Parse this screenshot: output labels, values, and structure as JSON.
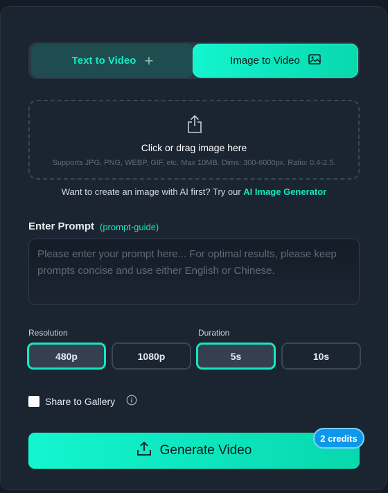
{
  "tabs": {
    "text_to_video": "Text to Video",
    "image_to_video": "Image to Video"
  },
  "upload": {
    "title": "Click or drag image here",
    "hint": "Supports JPG, PNG, WEBP, GIF, etc. Max 10MB. Dims: 300-6000px. Ratio: 0.4-2.5."
  },
  "ai_prompt": {
    "text": "Want to create an image with AI first? Try our ",
    "link": "AI Image Generator"
  },
  "prompt": {
    "label": "Enter Prompt",
    "guide": "(prompt-guide)",
    "value": "",
    "placeholder": "Please enter your prompt here... For optimal results, please keep prompts concise and use either English or Chinese."
  },
  "resolution": {
    "label": "Resolution",
    "options": [
      "480p",
      "1080p"
    ],
    "selected": "480p"
  },
  "duration": {
    "label": "Duration",
    "options": [
      "5s",
      "10s"
    ],
    "selected": "5s"
  },
  "share": {
    "label": "Share to Gallery",
    "checked": false
  },
  "generate": {
    "label": "Generate Video",
    "credits": "2 credits"
  },
  "colors": {
    "accent": "#14e8c0",
    "background": "#1b2431",
    "badge": "#0e97ea"
  },
  "icons": {
    "plus": "plus-icon",
    "image": "image-icon",
    "upload": "share-upload-icon",
    "info": "info-icon",
    "generate": "upload-icon"
  }
}
